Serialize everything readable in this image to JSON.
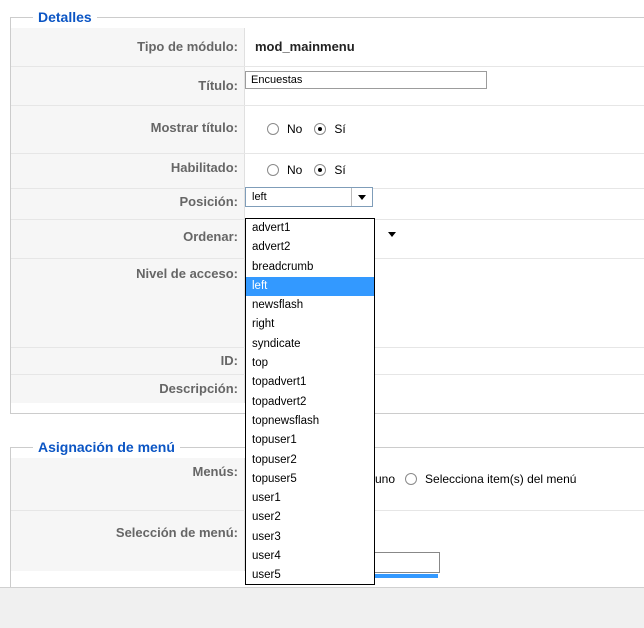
{
  "details": {
    "legend": "Detalles",
    "rows": {
      "module_type": {
        "label": "Tipo de módulo:",
        "value": "mod_mainmenu"
      },
      "title": {
        "label": "Título:",
        "value": "Encuestas"
      },
      "show_title": {
        "label": "Mostrar título:",
        "options": [
          "No",
          "Sí"
        ],
        "selected": "Sí"
      },
      "enabled": {
        "label": "Habilitado:",
        "options": [
          "No",
          "Sí"
        ],
        "selected": "Sí"
      },
      "position": {
        "label": "Posición:",
        "value": "left"
      },
      "order": {
        "label": "Ordenar:"
      },
      "access": {
        "label": "Nivel de acceso:"
      },
      "id": {
        "label": "ID:"
      },
      "description": {
        "label": "Descripción:"
      }
    }
  },
  "position_dropdown": {
    "options": [
      "advert1",
      "advert2",
      "breadcrumb",
      "left",
      "newsflash",
      "right",
      "syndicate",
      "top",
      "topadvert1",
      "topadvert2",
      "topnewsflash",
      "topuser1",
      "topuser2",
      "topuser5",
      "user1",
      "user2",
      "user3",
      "user4",
      "user5"
    ],
    "selected": "left"
  },
  "menu_assignment": {
    "legend": "Asignación de menú",
    "menus_label": "Menús:",
    "menus_option_partial": "uno",
    "menus_option_select": "Selecciona item(s) del menú",
    "selection_label": "Selección de menú:"
  }
}
